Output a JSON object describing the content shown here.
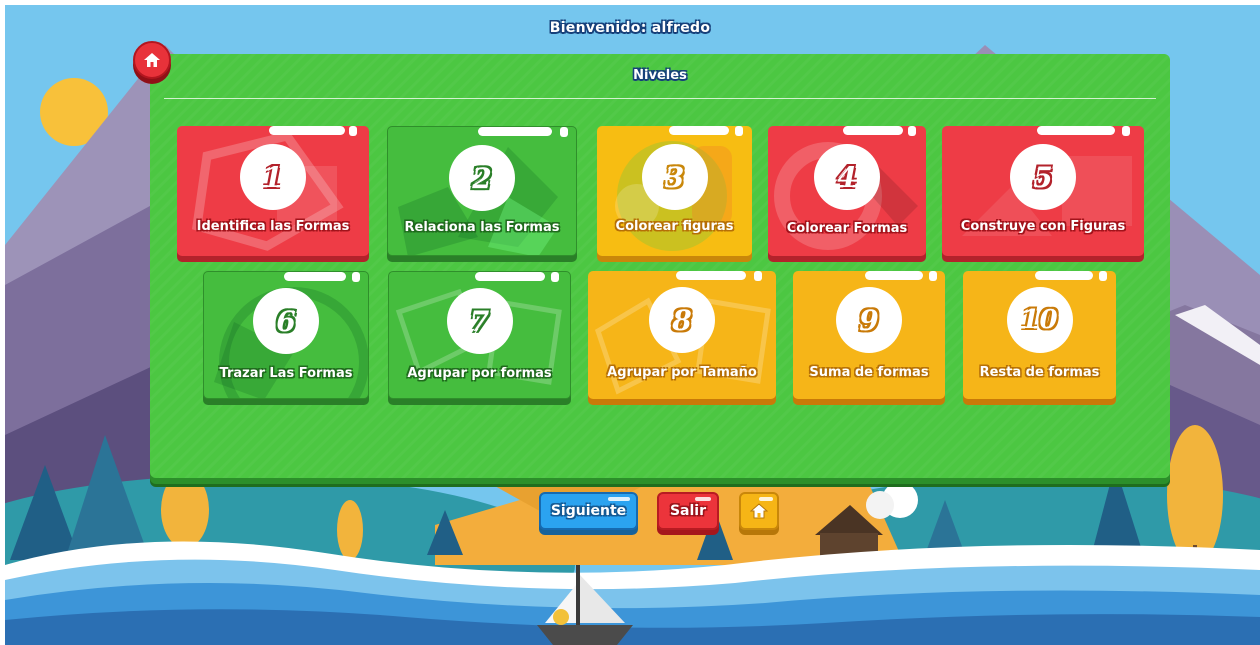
{
  "header": {
    "welcome": "Bienvenido: alfredo"
  },
  "panel": {
    "title": "Niveles"
  },
  "levels": [
    {
      "number": "1",
      "label": "Identifica las Formas"
    },
    {
      "number": "2",
      "label": "Relaciona las Formas"
    },
    {
      "number": "3",
      "label": "Colorear figuras"
    },
    {
      "number": "4",
      "label": "Colorear Formas"
    },
    {
      "number": "5",
      "label": "Construye con Figuras"
    },
    {
      "number": "6",
      "label": "Trazar Las Formas"
    },
    {
      "number": "7",
      "label": "Agrupar por formas"
    },
    {
      "number": "8",
      "label": "Agrupar por Tamaño"
    },
    {
      "number": "9",
      "label": "Suma de formas"
    },
    {
      "number": "10",
      "label": "Resta de formas"
    }
  ],
  "footer": {
    "next_label": "Siguiente",
    "exit_label": "Salir"
  },
  "colors": {
    "panel": "#4cc742",
    "red_tile": "#ee3c46",
    "green_tile": "#45bd3e",
    "yellow_tile": "#f7bd12",
    "next_button": "#2ba3f0",
    "exit_button": "#ec343b",
    "home_button": "#f6b516",
    "sky": "#75c6ee",
    "sea": "#2b7fc6"
  },
  "icons": {
    "home": "home-icon"
  }
}
